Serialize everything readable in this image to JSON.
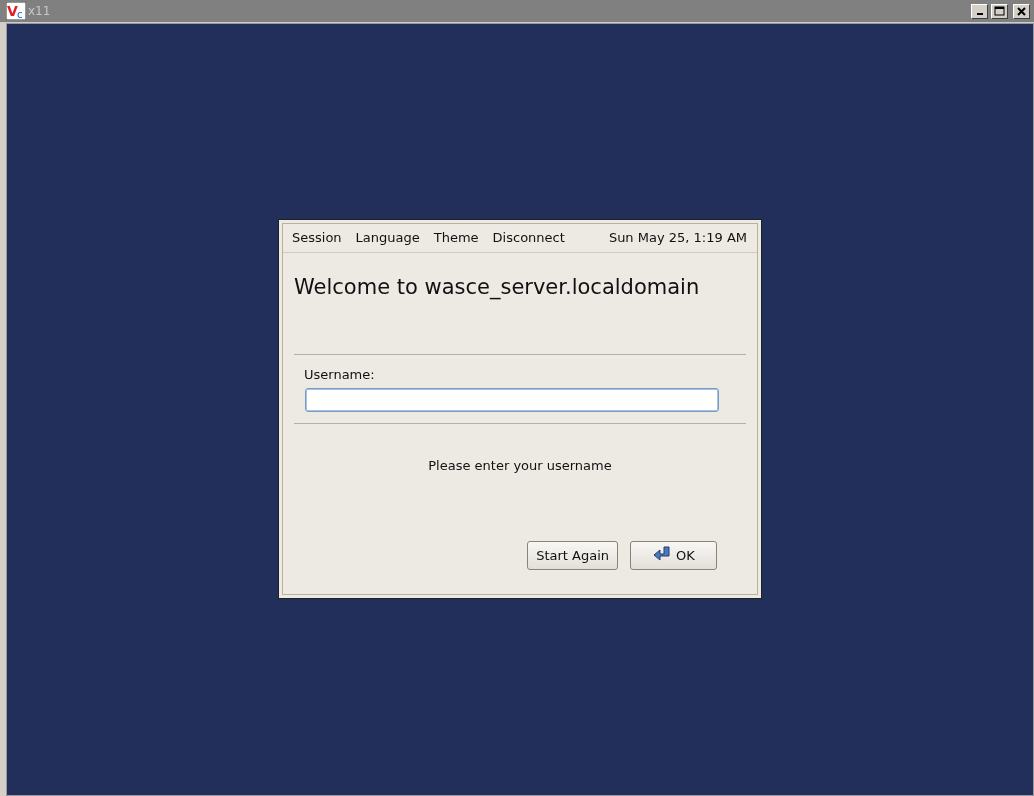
{
  "window": {
    "title": "x11",
    "logo": [
      "V",
      "c"
    ]
  },
  "menu": [
    "Session",
    "Language",
    "Theme",
    "Disconnect"
  ],
  "clock": "Sun May 25,  1:19 AM",
  "welcome": "Welcome to wasce_server.localdomain",
  "username": {
    "label": "Username:"
  },
  "message": "Please enter your username",
  "buttons": [
    {
      "label": "Start Again",
      "kind": "plain"
    },
    {
      "label": "OK",
      "kind": "ok"
    }
  ]
}
